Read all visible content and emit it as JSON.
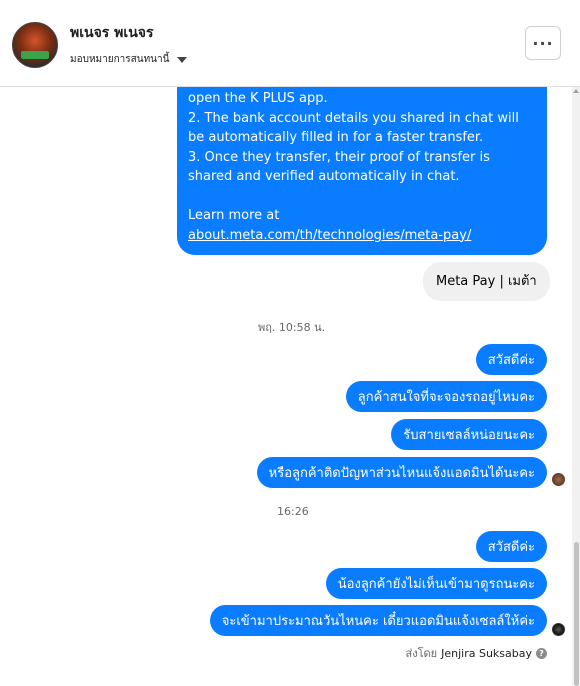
{
  "header": {
    "name": "พเนจร พเนจร",
    "assign_label": "มอบหมายการสนทนานี้",
    "more_label": "···"
  },
  "chat": {
    "big_message": {
      "lines": [
        "open the K PLUS app.",
        "2. The bank account details you shared in chat will be automatically filled in for a faster transfer.",
        "3. Once they transfer, their proof of transfer is shared and verified automatically in chat."
      ],
      "learn_more_prefix": "Learn more at ",
      "learn_more_link": "about.meta.com/th/technologies/meta-pay/"
    },
    "meta_pay_label": "Meta Pay | เมต้า",
    "timestamp_1": "พฤ. 10:58 น.",
    "group_1": [
      "สวัสดีค่ะ",
      "ลูกค้าสนใจที่จะจองรถอยู่ไหมคะ",
      "รับสายเซลล์หน่อยนะคะ",
      "หรือลูกค้าติดปัญหาส่วนไหนแจ้งแอดมินได้นะคะ"
    ],
    "timestamp_2": "16:26",
    "group_2": [
      "สวัสดีค่ะ",
      "น้องลูกค้ายังไม่เห็นเข้ามาดูรถนะคะ",
      "จะเข้ามาประมาณวันไหนคะ เดี๋ยวแอดมินแจ้งเซลล์ให้ค่ะ"
    ],
    "sent_by_prefix": "ส่งโดย",
    "sent_by_name": "Jenjira Suksabay",
    "help_icon_label": "?"
  },
  "colors": {
    "outgoing_bubble": "#0a7cff",
    "incoming_bubble": "#f0f0f0",
    "meta_text": "#65676b"
  },
  "icons": [
    "avatar",
    "chevron-down-icon",
    "more-options-icon",
    "seen-avatar-icon",
    "help-icon"
  ]
}
